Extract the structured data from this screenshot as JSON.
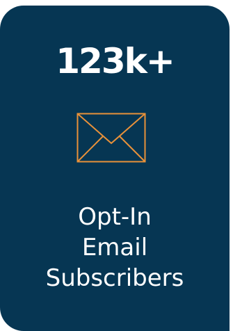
{
  "card": {
    "stat": "123k+",
    "label_lines": [
      "Opt-In",
      "Email",
      "Subscribers"
    ],
    "icon": "envelope-icon",
    "colors": {
      "background": "#063653",
      "text": "#ffffff",
      "icon": "#e8913a"
    }
  }
}
